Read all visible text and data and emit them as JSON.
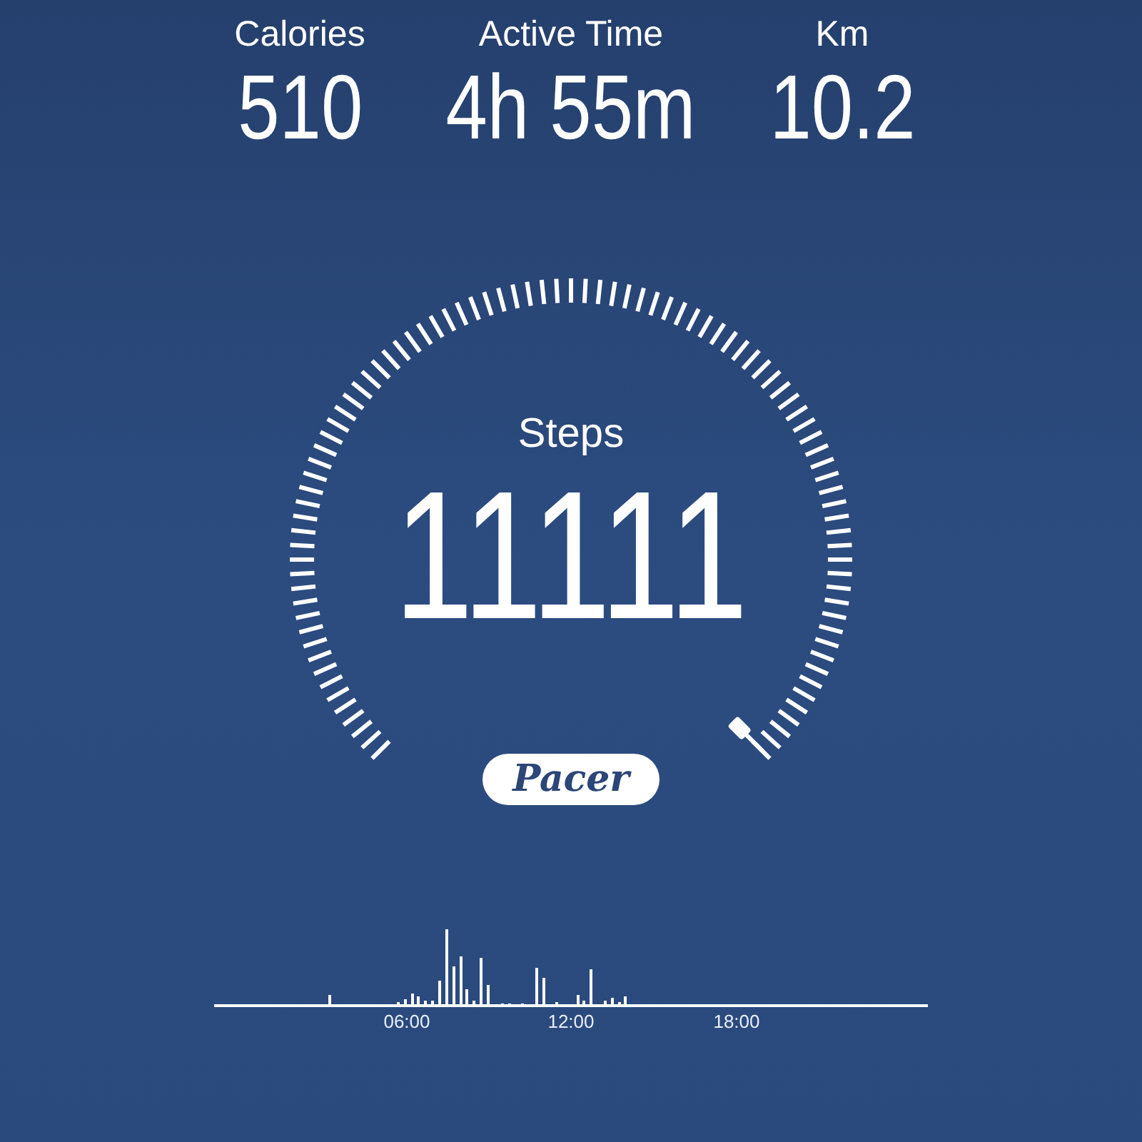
{
  "stats": [
    {
      "label": "Calories",
      "value": "510"
    },
    {
      "label": "Active Time",
      "value": "4h 55m"
    },
    {
      "label": "Km",
      "value": "10.2"
    }
  ],
  "steps": {
    "label": "Steps",
    "value": "11111"
  },
  "logo": {
    "text": "Pacer"
  },
  "activity_chart": {
    "x_labels": [
      "06:00",
      "12:00",
      "18:00"
    ]
  }
}
